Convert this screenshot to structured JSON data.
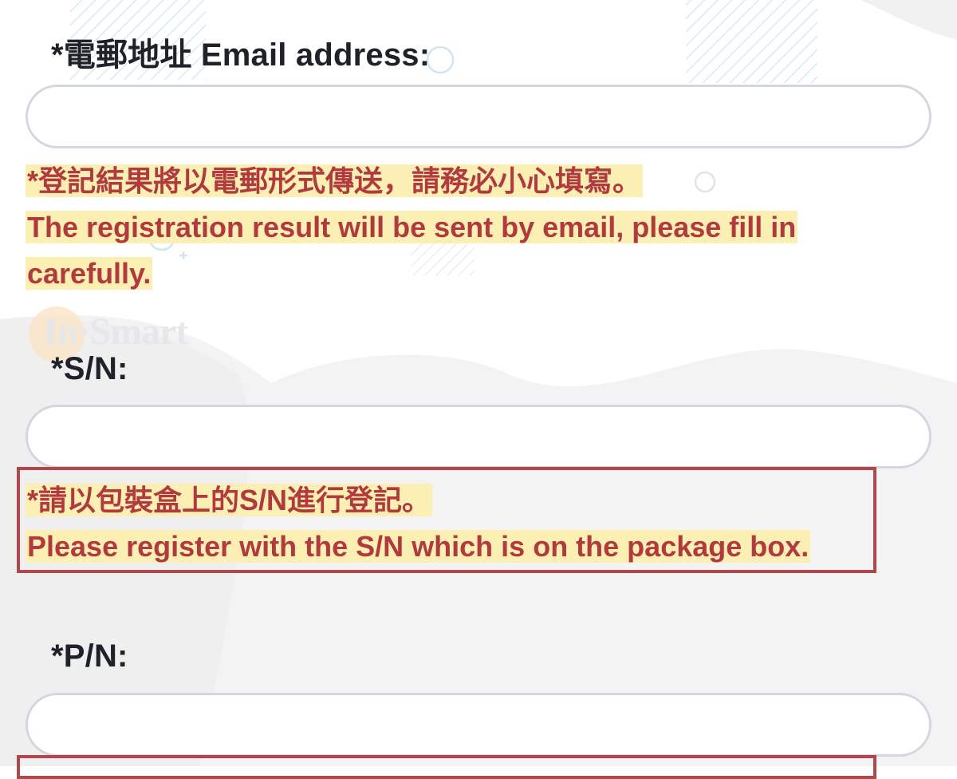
{
  "email": {
    "label": "*電郵地址 Email address:",
    "value": "",
    "note_zh": "*登記結果將以電郵形式傳送，請務必小心填寫。",
    "note_en_1": "The registration result will be sent by email, please fill in",
    "note_en_2": "carefully."
  },
  "watermark": {
    "text": "In·Smart"
  },
  "sn": {
    "label": "*S/N:",
    "value": "",
    "note_zh": "*請以包裝盒上的S/N進行登記。",
    "note_en": "Please register with the S/N which is on the package box."
  },
  "pn": {
    "label": "*P/N:",
    "value": ""
  },
  "colors": {
    "label_text": "#1f2329",
    "note_text": "#b03a3e",
    "highlight": "#fcefb4",
    "field_border": "#d3d7de",
    "annotation_box": "#b0474c"
  }
}
